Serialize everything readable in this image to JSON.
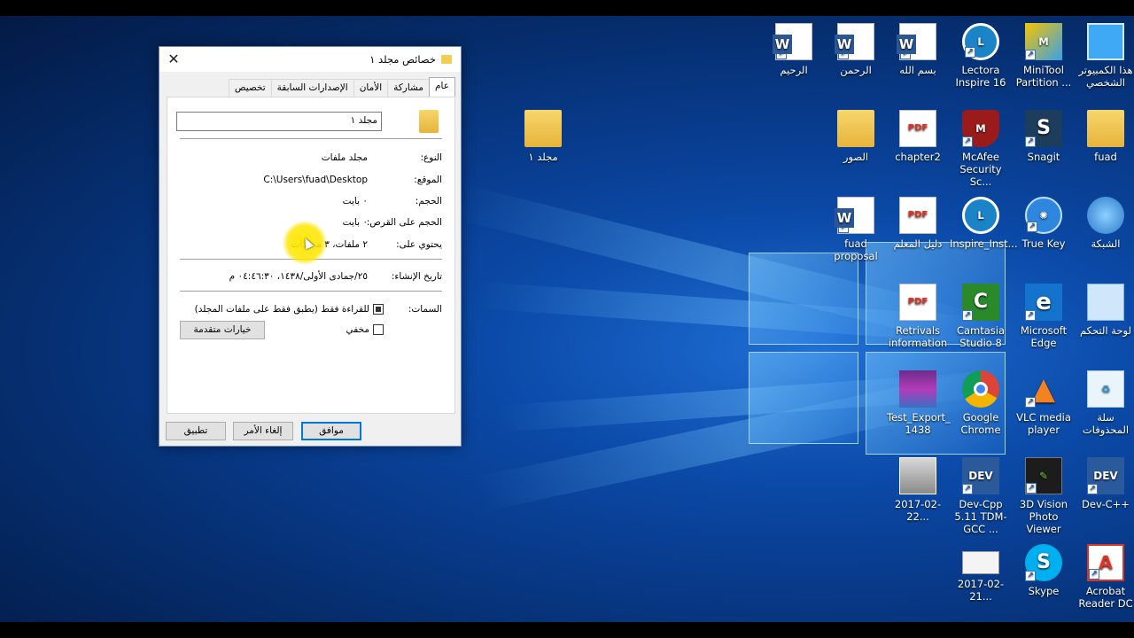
{
  "desktop_icons": [
    {
      "label": "الرحيم",
      "icon": "word-doc-icon"
    },
    {
      "label": "الرحمن",
      "icon": "word-doc-icon"
    },
    {
      "label": "بسم الله",
      "icon": "word-doc-icon"
    },
    {
      "label": "Lectora Inspire 16",
      "icon": "lectora-icon"
    },
    {
      "label": "MiniTool Partition ...",
      "icon": "minitool-icon"
    },
    {
      "label": "هذا الكمبيوتر الشخصي",
      "icon": "computer-icon"
    },
    {
      "label": "مجلد ١",
      "icon": "folder-icon"
    },
    {
      "label": "الصور",
      "icon": "folder-icon"
    },
    {
      "label": "chapter2",
      "icon": "pdf-icon"
    },
    {
      "label": "McAfee Security Sc...",
      "icon": "mcafee-icon"
    },
    {
      "label": "Snagit",
      "icon": "snagit-icon"
    },
    {
      "label": "fuad",
      "icon": "user-folder-icon"
    },
    {
      "label": "fuad proposal",
      "icon": "word-doc-icon"
    },
    {
      "label": "دليل المعلم",
      "icon": "pdf-icon"
    },
    {
      "label": "Inspire_Inst...",
      "icon": "lectora-icon"
    },
    {
      "label": "True Key",
      "icon": "truekey-icon"
    },
    {
      "label": "الشبكة",
      "icon": "network-icon"
    },
    {
      "label": "Retrivals information",
      "icon": "pdf-icon"
    },
    {
      "label": "Camtasia Studio 8",
      "icon": "camtasia-icon"
    },
    {
      "label": "Microsoft Edge",
      "icon": "edge-icon"
    },
    {
      "label": "لوحة التحكم",
      "icon": "control-panel-icon"
    },
    {
      "label": "Test_Export_ 1438",
      "icon": "winrar-icon"
    },
    {
      "label": "Google Chrome",
      "icon": "chrome-icon"
    },
    {
      "label": "VLC media player",
      "icon": "vlc-icon"
    },
    {
      "label": "سلة المحذوفات",
      "icon": "recycle-bin-icon"
    },
    {
      "label": "2017-02-22...",
      "icon": "image-file-icon"
    },
    {
      "label": "Dev-Cpp 5.11 TDM-GCC ...",
      "icon": "devcpp-icon"
    },
    {
      "label": "3D Vision Photo Viewer",
      "icon": "3dvision-icon"
    },
    {
      "label": "Dev-C++",
      "icon": "devcpp-icon"
    },
    {
      "label": "2017-02-21...",
      "icon": "image-file-icon"
    },
    {
      "label": "Skype",
      "icon": "skype-icon"
    },
    {
      "label": "Acrobat Reader DC",
      "icon": "acrobat-icon"
    }
  ],
  "dialog": {
    "title": "خصائص مجلد ١",
    "close_glyph": "✕",
    "tabs": [
      "عام",
      "مشاركة",
      "الأمان",
      "الإصدارات السابقة",
      "تخصيص"
    ],
    "active_tab": "عام",
    "folder_name": "مجلد ١",
    "rows": [
      {
        "label": "النوع:",
        "value": "مجلد ملفات"
      },
      {
        "label": "الموقع:",
        "value": "C:\\Users\\fuad\\Desktop"
      },
      {
        "label": "الحجم:",
        "value": "٠ بايت"
      },
      {
        "label": "الحجم على القرص:",
        "value": "٠ بايت"
      },
      {
        "label": "يحتوي على:",
        "value": "٢ ملفات، ٣ مجلدات"
      }
    ],
    "created_label": "تاريخ الإنشاء:",
    "created_value": "٢٥/جمادى الأولى/١٤٣٨، ٠٤:٤٦:٣٠ م",
    "attributes_label": "السمات:",
    "readonly_label": "للقراءة فقط (يطبق فقط على ملفات المجلد)",
    "hidden_label": "مخفي",
    "advanced_button": "خيارات متقدمة",
    "ok_button": "موافق",
    "cancel_button": "إلغاء الأمر",
    "apply_button": "تطبيق"
  }
}
